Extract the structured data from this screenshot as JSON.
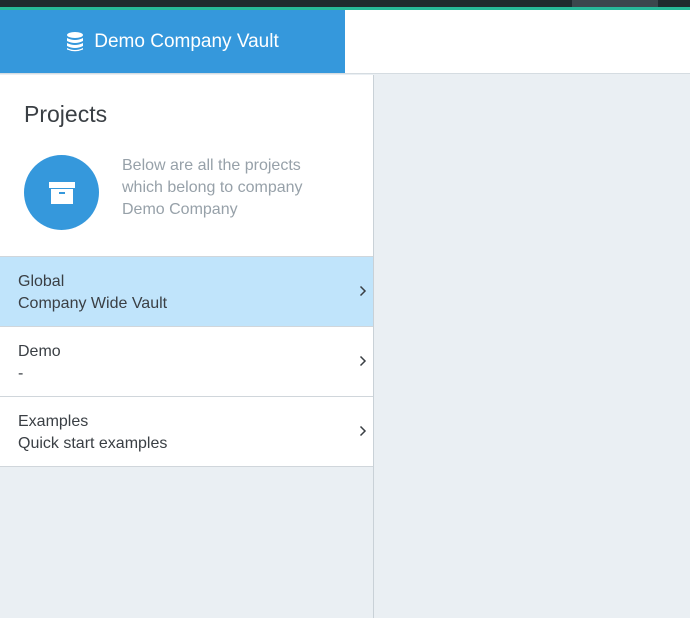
{
  "header": {
    "vault_title": "Demo Company Vault",
    "icon": "database-icon"
  },
  "projects_panel": {
    "title": "Projects",
    "icon": "archive-icon",
    "description": "Below are all the projects which belong to company Demo Company",
    "items": [
      {
        "name": "Global",
        "subtitle": "Company Wide Vault",
        "selected": true
      },
      {
        "name": "Demo",
        "subtitle": "-",
        "selected": false
      },
      {
        "name": "Examples",
        "subtitle": "Quick start examples",
        "selected": false
      }
    ]
  },
  "colors": {
    "accent_blue": "#3598dc",
    "selected_row": "#c0e4fb",
    "top_accent": "#27b99a",
    "background": "#eaeff3"
  }
}
